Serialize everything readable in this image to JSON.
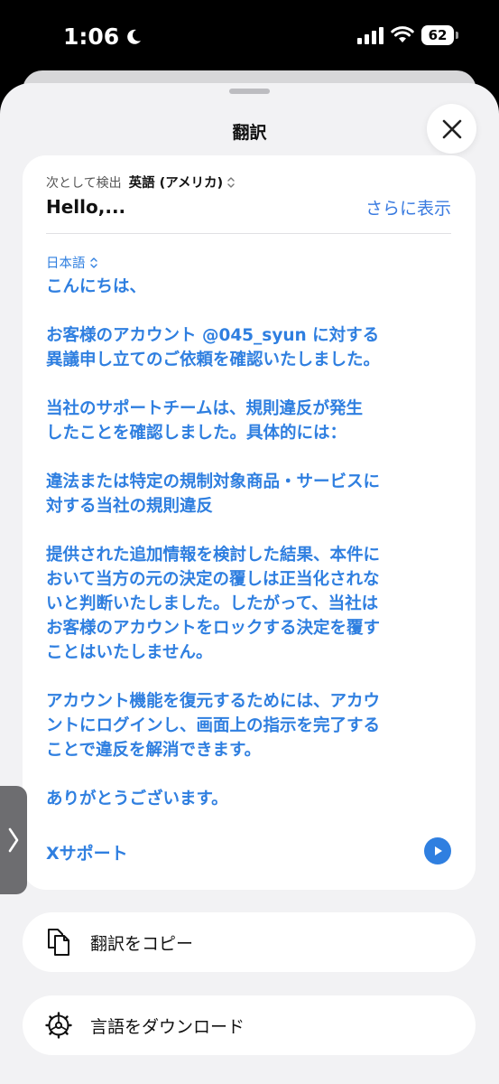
{
  "status_bar": {
    "time": "1:06",
    "battery": "62"
  },
  "sheet": {
    "title": "翻訳"
  },
  "source": {
    "detect_label": "次として検出",
    "language": "英語 (アメリカ)",
    "text": "Hello,...",
    "show_more": "さらに表示"
  },
  "target": {
    "language": "日本語",
    "lines": [
      "こんにちは、",
      "",
      "お客様のアカウント @045_syun に対する",
      "異議申し立てのご依頼を確認いたしました。",
      "",
      "当社のサポートチームは、規則違反が発生",
      "したことを確認しました。具体的には：",
      "",
      "違法または特定の規制対象商品・サービスに",
      "対する当社の規則違反",
      "",
      "提供された追加情報を検討した結果、本件に",
      "おいて当方の元の決定の覆しは正当化されな",
      "いと判断いたしました。したがって、当社は",
      "お客様のアカウントをロックする決定を覆す",
      "ことはいたしません。",
      "",
      "アカウント機能を復元するためには、アカウ",
      "ントにログインし、画面上の指示を完了する",
      "ことで違反を解消できます。",
      "",
      "ありがとうございます。"
    ],
    "signature": "Xサポート"
  },
  "actions": {
    "copy": "翻訳をコピー",
    "download": "言語をダウンロード"
  },
  "colors": {
    "accent": "#2f7fe0",
    "sheet_bg": "#f2f2f4",
    "card_bg": "#ffffff"
  },
  "icons": {
    "moon": "moon-icon",
    "signal": "cellular-signal-icon",
    "wifi": "wifi-icon",
    "close": "close-icon",
    "updown": "chevron-up-down-icon",
    "play": "play-icon",
    "copy": "copy-documents-icon",
    "gear": "gear-icon",
    "edge": "chevron-right-icon"
  }
}
